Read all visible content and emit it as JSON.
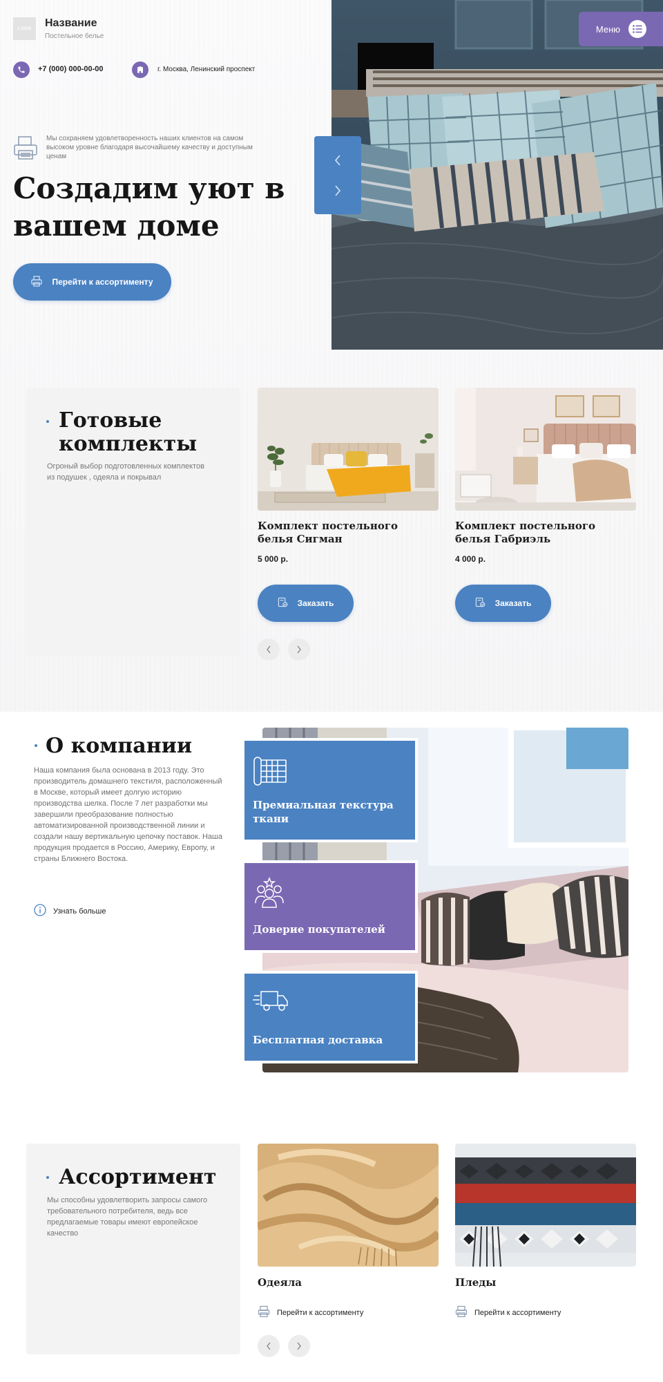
{
  "header": {
    "logo_text": "LOGO",
    "site_name": "Название",
    "site_sub": "Постельное белье",
    "phone": "+7 (000) 000-00-00",
    "address": "г. Москва, Ленинский проспект",
    "menu_label": "Меню"
  },
  "hero": {
    "description": "Мы сохраняем удовлетворенность наших клиентов на самом высоком уровне благодаря высочайшему качеству и доступным ценам",
    "title": "Создадим уют в вашем доме",
    "button_label": "Перейти к ассортименту"
  },
  "sets": {
    "title": "Готовые комплекты",
    "description": "Огроный выбор подготовленных комплектов из подушек , одеяла и покрывал",
    "products": [
      {
        "name": "Комплект постельного белья Сигман",
        "price": "5 000 р.",
        "button": "Заказать"
      },
      {
        "name": "Комплект постельного белья Габриэль",
        "price": "4 000 р.",
        "button": "Заказать"
      }
    ]
  },
  "about": {
    "title": "О компании",
    "text": "Наша компания была основана в 2013 году. Это производитель домашнего текстиля, расположенный в Москве, который имеет долгую историю производства шелка. После 7 лет разработки мы завершили преобразование полностью автоматизированной производственной линии и создали нашу вертикальную цепочку поставок. Наша продукция продается в Россию, Америку, Европу, и страны Ближнего Востока.",
    "more_link": "Узнать больше",
    "features": [
      {
        "label": "Премиальная текстура ткани",
        "icon": "fabric-texture-icon",
        "color": "#4a82c2"
      },
      {
        "label": "Доверие покупателей",
        "icon": "customers-icon",
        "color": "#7b68b3"
      },
      {
        "label": "Бесплатная доставка",
        "icon": "delivery-truck-icon",
        "color": "#4a82c2"
      }
    ]
  },
  "assortment": {
    "title": "Ассортимент",
    "description": "Мы способны удовлетворить запросы самого требовательного потребителя, ведь все предлагаемые товары имеют европейское качество",
    "categories": [
      {
        "name": "Одеяла",
        "link": "Перейти к ассортименту"
      },
      {
        "name": "Пледы",
        "link": "Перейти к ассортименту"
      }
    ]
  },
  "colors": {
    "accent_blue": "#4a82c2",
    "accent_purple": "#7b68b3"
  }
}
